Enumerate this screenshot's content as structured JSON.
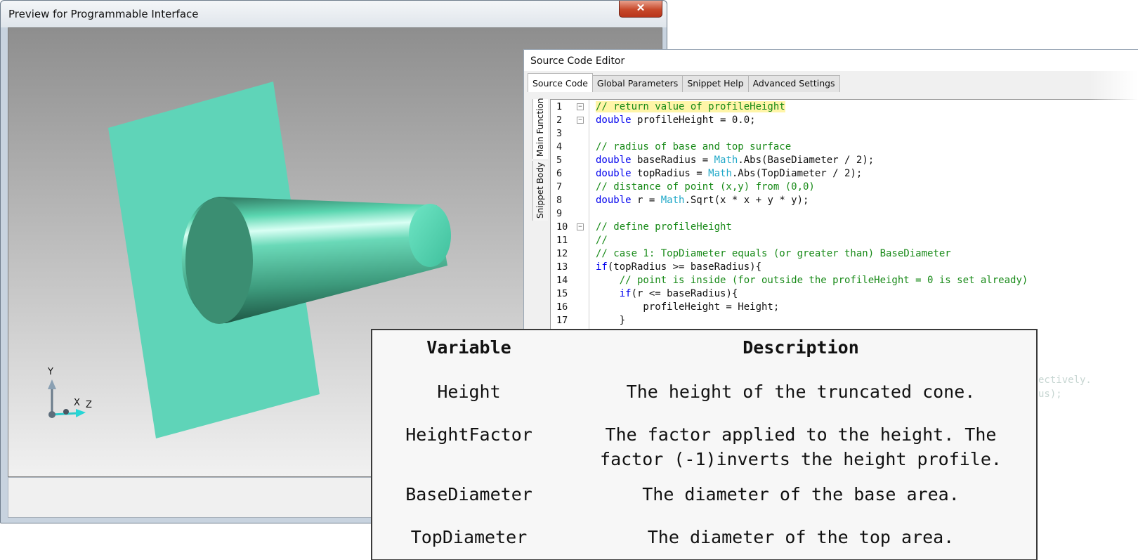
{
  "preview": {
    "title": "Preview for Programmable Interface",
    "close_glyph": "✕",
    "axes": {
      "y": "Y",
      "x": "X",
      "z": "Z"
    }
  },
  "editor": {
    "title": "Source Code Editor",
    "tabs": [
      "Source Code",
      "Global Parameters",
      "Snippet Help",
      "Advanced Settings"
    ],
    "active_tab": "Source Code",
    "side_tabs": [
      "Main Function",
      "Snippet Body"
    ],
    "line_numbers": [
      "1",
      "2",
      "3",
      "4",
      "5",
      "6",
      "7",
      "8",
      "9",
      "10",
      "11",
      "12",
      "13",
      "14",
      "15",
      "16",
      "17"
    ],
    "code": {
      "l1": "// return value of profileHeight",
      "l2a": "double",
      "l2b": " profileHeight = 0.0;",
      "l4": "// radius of base and top surface",
      "l5a": "double",
      "l5b": " baseRadius = ",
      "l5c": "Math",
      "l5d": ".Abs(BaseDiameter / 2);",
      "l6a": "double",
      "l6b": " topRadius = ",
      "l6c": "Math",
      "l6d": ".Abs(TopDiameter / 2);",
      "l7": "// distance of point (x,y) from (0,0)",
      "l8a": "double",
      "l8b": " r = ",
      "l8c": "Math",
      "l8d": ".Sqrt(x * x + y * y);",
      "l10": "// define profileHeight",
      "l11": "//",
      "l12": "// case 1: TopDiameter equals (or greater than) BaseDiameter",
      "l13a": "if",
      "l13b": "(topRadius >= baseRadius){",
      "l14": "    // point is inside (for outside the profileHeight = 0 is set already)",
      "l15a": "    if",
      "l15b": "(r <= baseRadius){",
      "l16": "        profileHeight = Height;",
      "l17": "    }"
    },
    "ghost_1": "ectively.",
    "ghost_2": "us);"
  },
  "table": {
    "headers": {
      "variable": "Variable",
      "description": "Description"
    },
    "rows": [
      {
        "variable": "Height",
        "description_1": "The height of the truncated cone.",
        "description_2": ""
      },
      {
        "variable": "HeightFactor",
        "description_1": "The factor applied to the height. The",
        "description_2": "factor (-1)inverts the height profile."
      },
      {
        "variable": "BaseDiameter",
        "description_1": "The diameter of the base area.",
        "description_2": ""
      },
      {
        "variable": "TopDiameter",
        "description_1": "The diameter of the top area.",
        "description_2": ""
      }
    ]
  },
  "colors": {
    "plane": "#5fd4b8",
    "cone": "#2e8c70",
    "keyword": "#0000ee",
    "comment": "#188a18",
    "class": "#20a8c8"
  },
  "icons": [
    "close-icon",
    "coordinate-axes-icon"
  ]
}
